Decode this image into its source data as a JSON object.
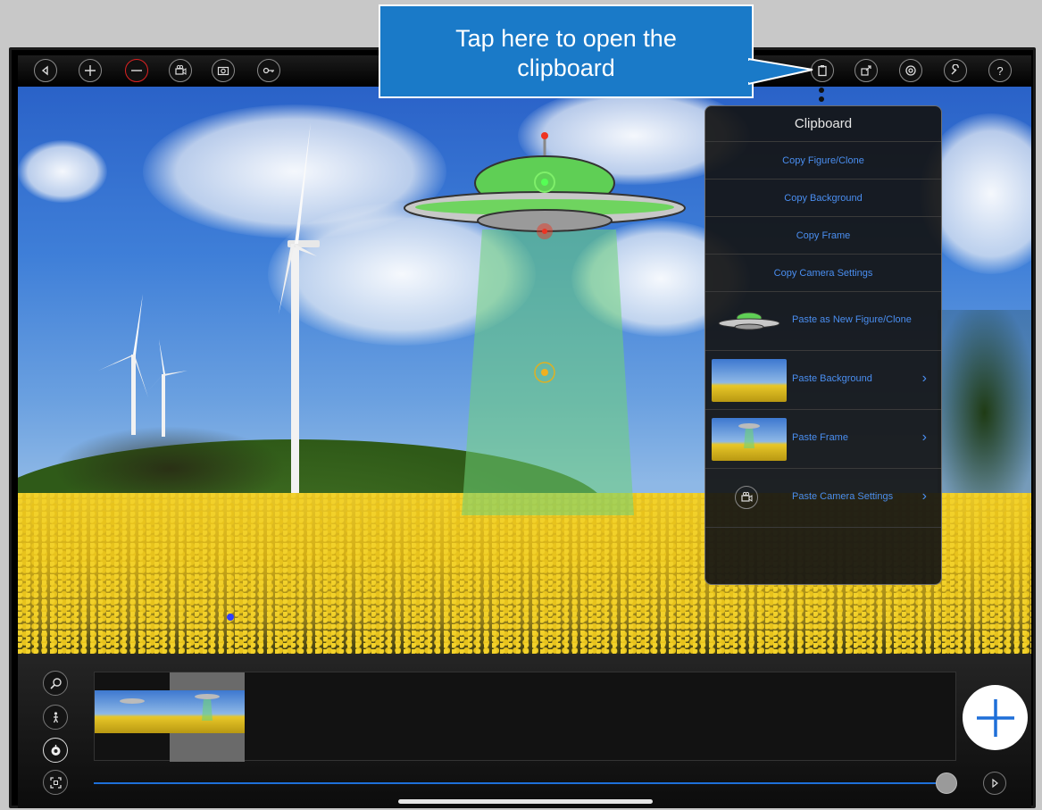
{
  "callout": {
    "text_line1": "Tap here to open the",
    "text_line2": "clipboard"
  },
  "toolbar": {
    "left_icons": [
      "back-icon",
      "add-icon",
      "remove-icon",
      "camera-icon",
      "snapshot-icon",
      "key-icon"
    ],
    "right_icons": [
      "clipboard-icon",
      "export-icon",
      "settings-icon",
      "tools-icon",
      "help-icon"
    ],
    "help_glyph": "?"
  },
  "clipboard": {
    "title": "Clipboard",
    "copy_items": [
      {
        "label": "Copy Figure/Clone"
      },
      {
        "label": "Copy Background"
      },
      {
        "label": "Copy Frame"
      },
      {
        "label": "Copy Camera Settings"
      }
    ],
    "paste_items": [
      {
        "label": "Paste as New Figure/Clone",
        "has_chevron": false
      },
      {
        "label": "Paste Background",
        "has_chevron": true
      },
      {
        "label": "Paste Frame",
        "has_chevron": true
      },
      {
        "label": "Paste Camera Settings",
        "has_chevron": true
      }
    ],
    "chevron": "›"
  },
  "timeline": {
    "side_icons": [
      "zoom-icon",
      "figure-icon",
      "record-icon",
      "fit-icon"
    ],
    "frames": 2,
    "selected_frame": 2,
    "play_icon": "play-icon"
  },
  "colors": {
    "accent": "#4a8ef0",
    "callout": "#1a7ac8",
    "scrubber": "#1e6fd8"
  }
}
